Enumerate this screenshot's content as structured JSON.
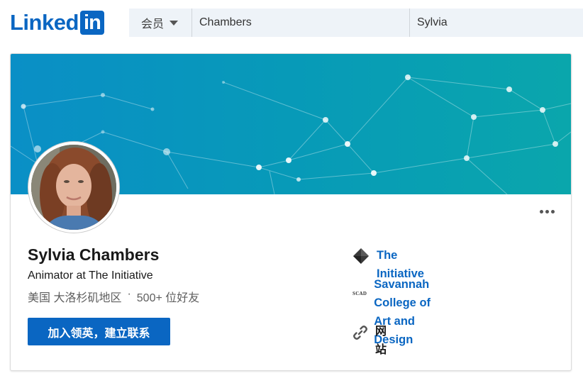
{
  "header": {
    "logo_text": "Linked",
    "logo_box_text": "in",
    "search_category": "会员",
    "last_name_value": "Chambers",
    "first_name_value": "Sylvia"
  },
  "profile": {
    "name": "Sylvia Chambers",
    "headline": "Animator at The Initiative",
    "location": "美国 大洛杉矶地区",
    "separator": "·",
    "connections": "500+ 位好友",
    "join_button": "加入领英，建立联系"
  },
  "sidebar": {
    "company": "The Initiative",
    "school_line1": "Savannah College of Art and",
    "school_line2": "Design",
    "school_logo_text": "SCAD",
    "website_label": "网站"
  },
  "icons": {
    "company": "diamond-icon",
    "school": "scad-logo-icon",
    "website": "link-icon",
    "more": "more-options-icon"
  },
  "colors": {
    "brand": "#0a66c2",
    "cover_start": "#0a8fc4",
    "cover_end": "#0aa6b0"
  }
}
